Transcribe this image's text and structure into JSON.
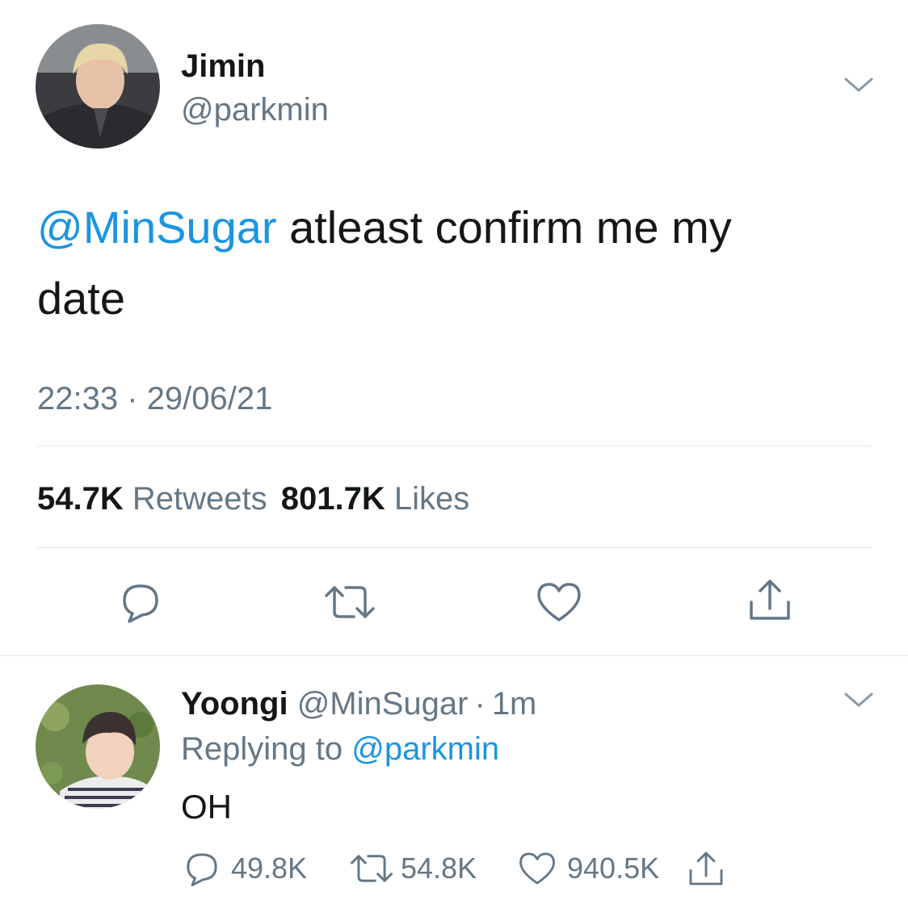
{
  "main_tweet": {
    "author_name": "Jimin",
    "author_handle": "@parkmin",
    "mention": "@MinSugar",
    "text": " atleast confirm me my date",
    "time": "22:33",
    "separator": "·",
    "date": "29/06/21",
    "retweet_count": "54.7K",
    "retweet_label": "Retweets",
    "like_count": "801.7K",
    "like_label": "Likes"
  },
  "reply": {
    "author_name": "Yoongi",
    "author_handle": "@MinSugar",
    "separator": "·",
    "time_ago": "1m",
    "replying_label": "Replying to",
    "replying_handle": "@parkmin",
    "text": "OH",
    "reply_count": "49.8K",
    "retweet_count": "54.8K",
    "like_count": "940.5K"
  },
  "icons": [
    "chevron-down-icon",
    "reply-icon",
    "retweet-icon",
    "like-icon",
    "share-icon"
  ],
  "colors": {
    "link": "#1b95e0",
    "muted": "#657786",
    "text": "#14171a",
    "divider": "#e1e8ed"
  }
}
